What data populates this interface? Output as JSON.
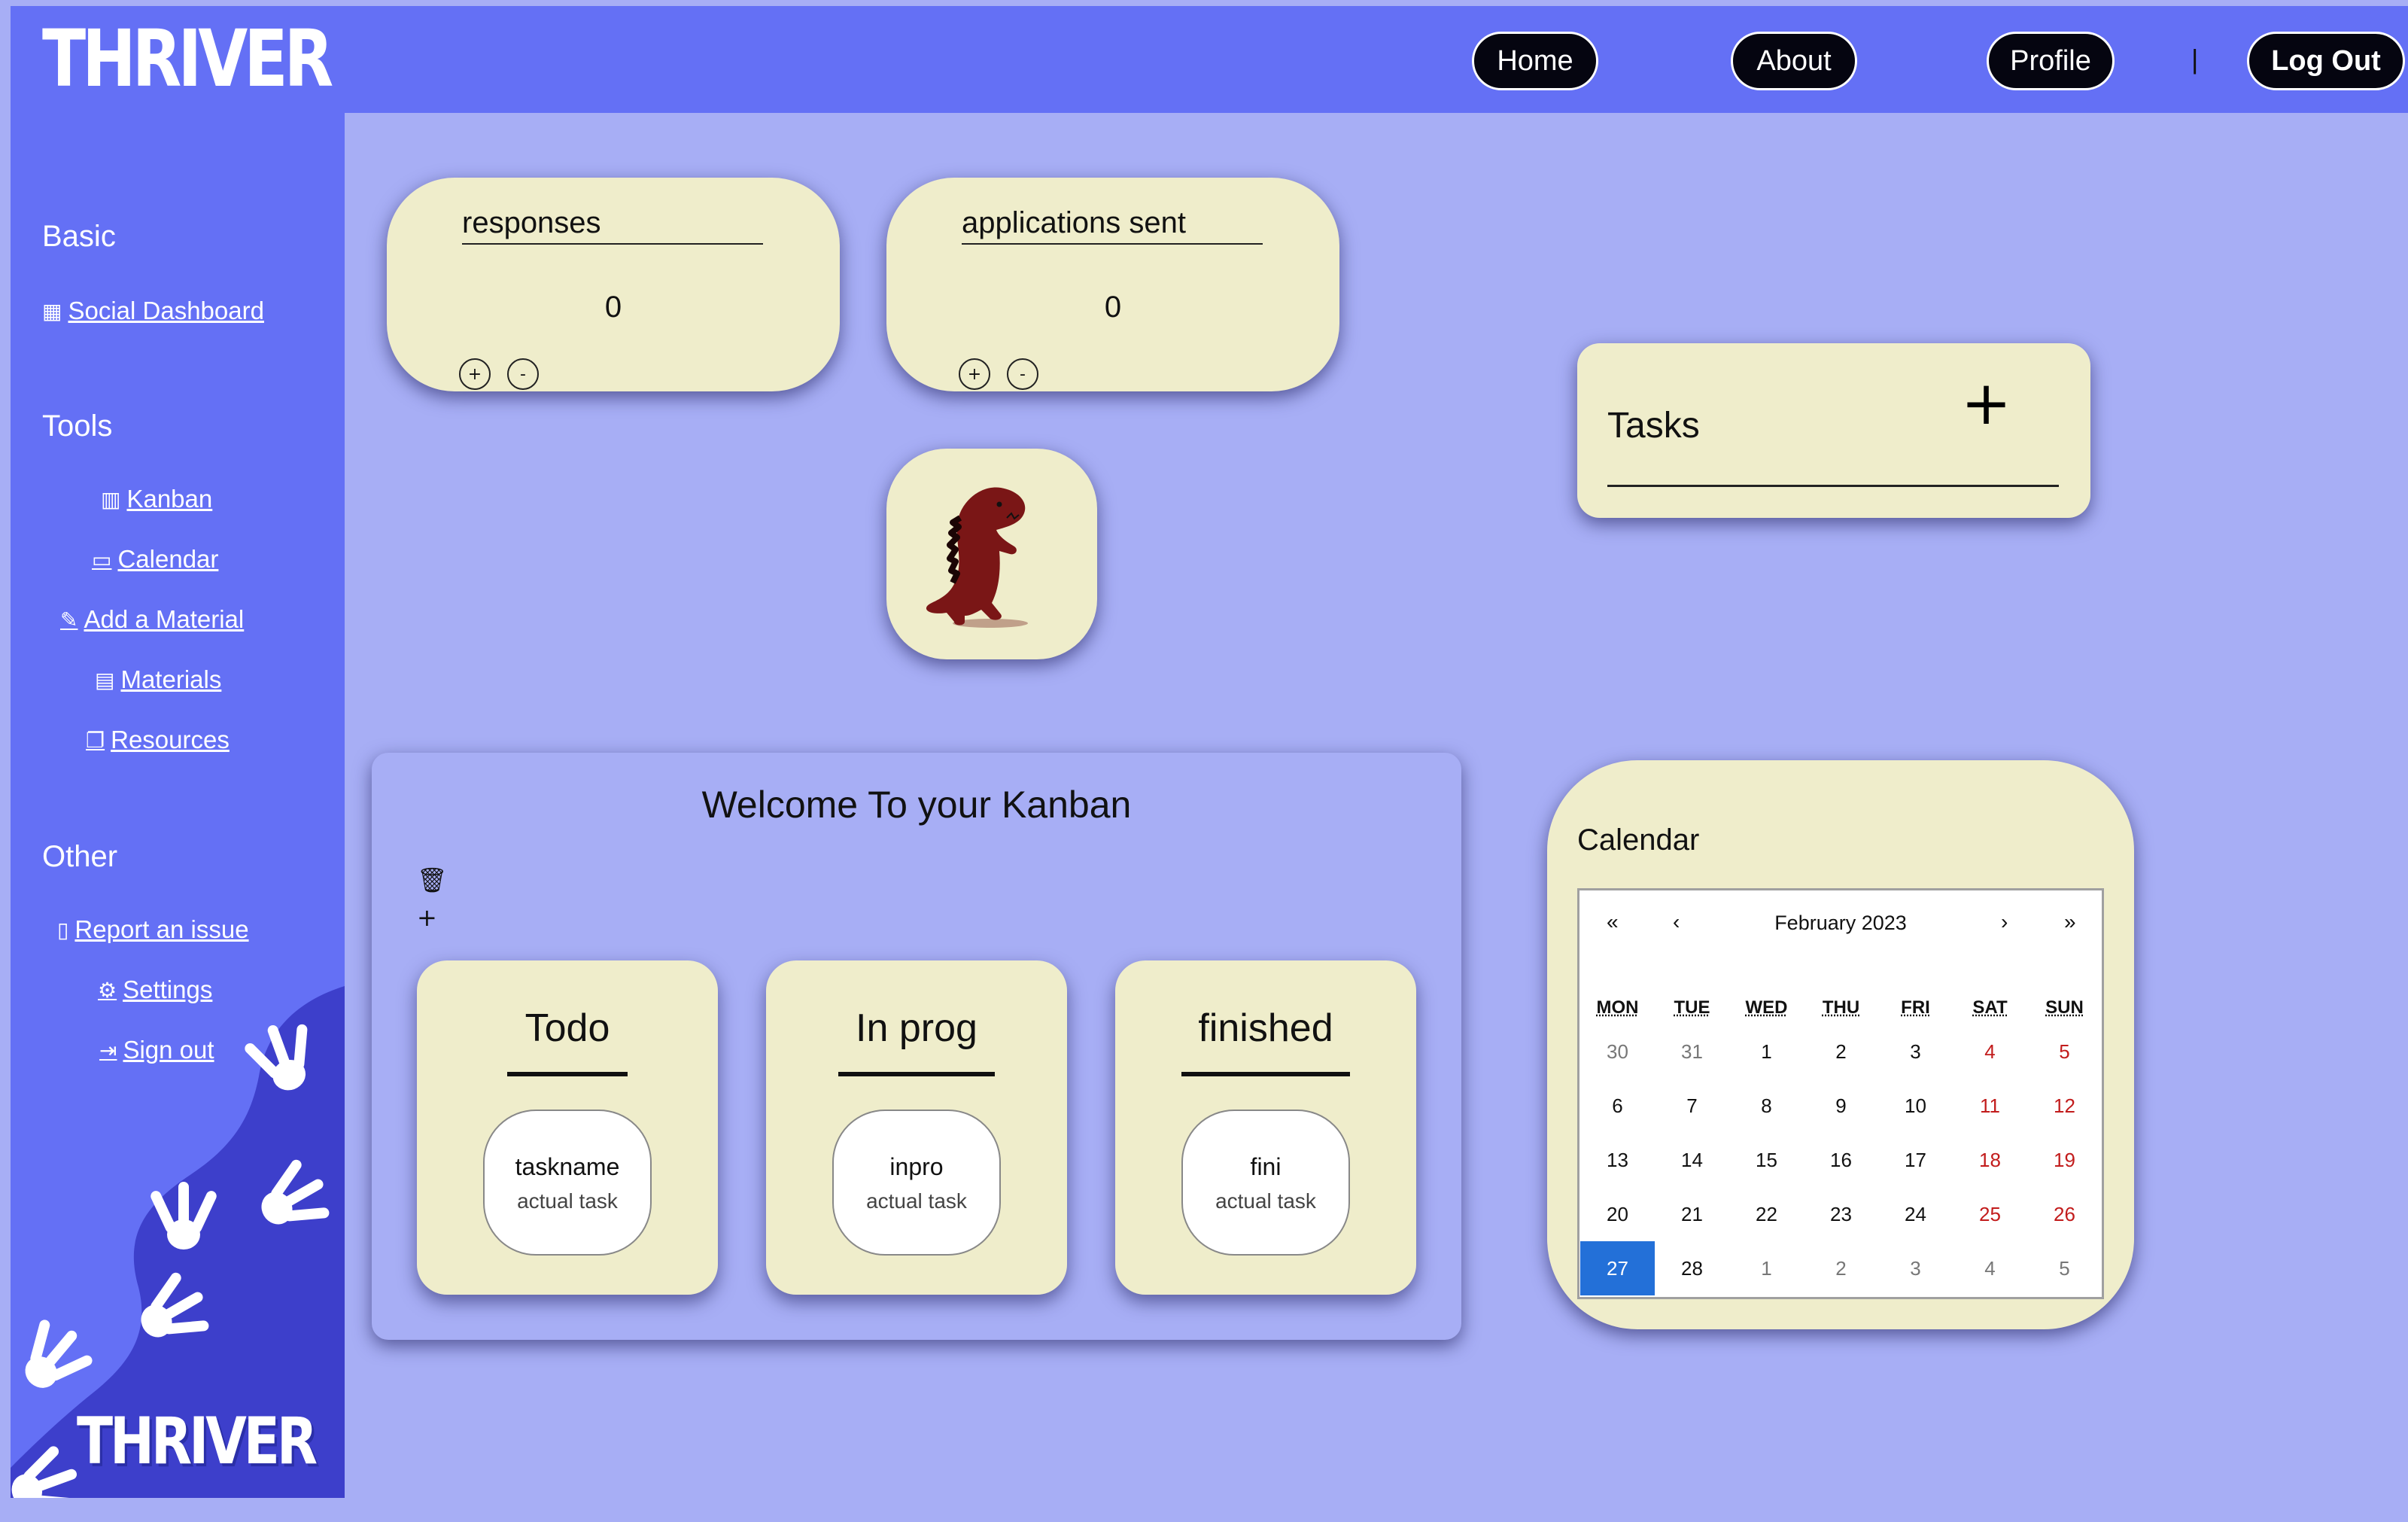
{
  "app": {
    "logo": "THRIVER"
  },
  "nav": {
    "home": "Home",
    "about": "About",
    "profile": "Profile",
    "separator": "|",
    "logout": "Log Out"
  },
  "sidebar": {
    "basic_heading": "Basic",
    "social_dashboard": "Social Dashboard",
    "tools_heading": "Tools",
    "kanban": "Kanban",
    "calendar": "Calendar",
    "add_material": "Add a Material",
    "materials": "Materials",
    "resources": "Resources",
    "other_heading": "Other",
    "report_issue": "Report an issue",
    "settings": "Settings",
    "sign_out": "Sign out",
    "logo": "THRIVER"
  },
  "counters": [
    {
      "title": "responses",
      "value": "0",
      "plus": "+",
      "minus": "-"
    },
    {
      "title": "applications sent",
      "value": "0",
      "plus": "+",
      "minus": "-"
    }
  ],
  "tasks": {
    "title": "Tasks",
    "add": "+"
  },
  "kanban": {
    "title": "Welcome To your Kanban",
    "trash_icon": "🗑",
    "add": "+",
    "columns": [
      {
        "title": "Todo",
        "task_name": "taskname",
        "task_desc": "actual task"
      },
      {
        "title": "In prog",
        "task_name": "inpro",
        "task_desc": "actual task"
      },
      {
        "title": "finished",
        "task_name": "fini",
        "task_desc": "actual task"
      }
    ]
  },
  "calendar": {
    "title": "Calendar",
    "month": "February 2023",
    "nav": {
      "prev_year": "«",
      "prev": "‹",
      "next": "›",
      "next_year": "»"
    },
    "weekdays": [
      "MON",
      "TUE",
      "WED",
      "THU",
      "FRI",
      "SAT",
      "SUN"
    ],
    "weeks": [
      [
        "30",
        "31",
        "1",
        "2",
        "3",
        "4",
        "5"
      ],
      [
        "6",
        "7",
        "8",
        "9",
        "10",
        "11",
        "12"
      ],
      [
        "13",
        "14",
        "15",
        "16",
        "17",
        "18",
        "19"
      ],
      [
        "20",
        "21",
        "22",
        "23",
        "24",
        "25",
        "26"
      ],
      [
        "27",
        "28",
        "1",
        "2",
        "3",
        "4",
        "5"
      ]
    ],
    "selected": "27",
    "colors": {
      "weekend": "#c21c1c",
      "selected": "#2370d8",
      "other_month": "#777777"
    }
  },
  "colors": {
    "background": "#a7aef5",
    "navbar": "#6470f5",
    "card": "#efedcb"
  }
}
